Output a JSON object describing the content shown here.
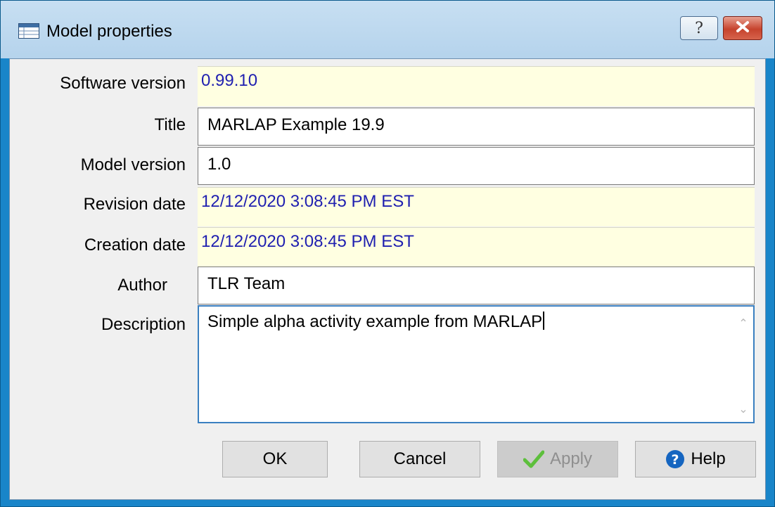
{
  "window": {
    "title": "Model properties",
    "help_glyph": "?",
    "icons": {
      "app": "table-window-icon",
      "help": "question-icon",
      "close": "close-x-icon"
    }
  },
  "form": {
    "software_version": {
      "label": "Software version",
      "value": "0.99.10"
    },
    "title": {
      "label": "Title",
      "value": "MARLAP Example 19.9"
    },
    "model_version": {
      "label": "Model version",
      "value": "1.0"
    },
    "revision_date": {
      "label": "Revision date",
      "value": "12/12/2020 3:08:45 PM EST"
    },
    "creation_date": {
      "label": "Creation date",
      "value": "12/12/2020 3:08:45 PM EST"
    },
    "author": {
      "label": "Author",
      "value": "TLR Team"
    },
    "description": {
      "label": "Description",
      "value": "Simple alpha activity example from MARLAP"
    }
  },
  "buttons": {
    "ok": "OK",
    "cancel": "Cancel",
    "apply": "Apply",
    "help": "Help"
  },
  "colors": {
    "readonly_bg": "#ffffe1",
    "readonly_text": "#1f1fb0",
    "frame": "#1985c9",
    "apply_check": "#5dbf3c",
    "help_icon": "#1565c0"
  }
}
